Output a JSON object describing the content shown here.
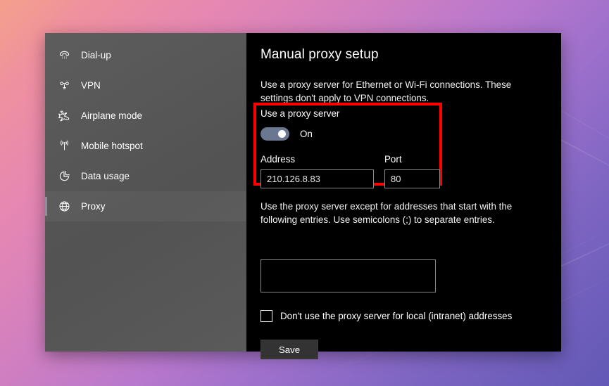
{
  "wallpaper": {
    "gradient_start": "#f4a08c",
    "gradient_mid": "#b878cd",
    "gradient_end": "#6258b5"
  },
  "sidebar": {
    "items": [
      {
        "label": "Dial-up",
        "icon": "phone-icon",
        "selected": false
      },
      {
        "label": "VPN",
        "icon": "vpn-icon",
        "selected": false
      },
      {
        "label": "Airplane mode",
        "icon": "airplane-icon",
        "selected": false
      },
      {
        "label": "Mobile hotspot",
        "icon": "hotspot-icon",
        "selected": false
      },
      {
        "label": "Data usage",
        "icon": "pie-chart-icon",
        "selected": false
      },
      {
        "label": "Proxy",
        "icon": "globe-icon",
        "selected": true
      }
    ]
  },
  "main": {
    "title": "Manual proxy setup",
    "intro": "Use a proxy server for Ethernet or Wi-Fi connections. These settings don't apply to VPN connections.",
    "proxy_toggle": {
      "label": "Use a proxy server",
      "state": "On"
    },
    "address": {
      "label": "Address",
      "value": "210.126.8.83",
      "placeholder": ""
    },
    "port": {
      "label": "Port",
      "value": "80",
      "placeholder": ""
    },
    "exceptions": {
      "description": "Use the proxy server except for addresses that start with the following entries. Use semicolons (;) to separate entries.",
      "value": "",
      "placeholder": ""
    },
    "bypass_local": {
      "label": "Don't use the proxy server for local (intranet) addresses",
      "checked": false
    },
    "save_label": "Save"
  },
  "highlight": {
    "color": "#ff0000"
  }
}
